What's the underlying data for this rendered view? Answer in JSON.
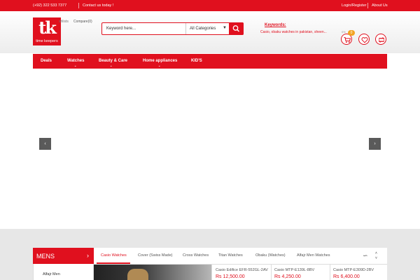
{
  "topbar": {
    "phone": "(+92) 322 533 7377",
    "contact": "Contact us today !",
    "login": "Login/Register",
    "about": "About Us"
  },
  "header": {
    "logo_mark": "tk",
    "logo_name": "time keepers",
    "wishlist_label": "shlists",
    "compare_label": "Compare(0)",
    "search_placeholder": "Keyword here...",
    "category_selected": "All Categories",
    "keywords_title": "Keywords:",
    "keywords_text": "Casio, obaku watches in pakistan, sheen...",
    "cart_count": "0",
    "cart_small_label": "0%"
  },
  "nav": {
    "items": [
      {
        "label": "Deals",
        "has_sub": false
      },
      {
        "label": "Watches",
        "has_sub": true
      },
      {
        "label": "Beauty & Care",
        "has_sub": true
      },
      {
        "label": "Home appliances",
        "has_sub": true
      },
      {
        "label": "KID'S",
        "has_sub": false
      }
    ]
  },
  "slider": {
    "prev_icon": "chevron-left-icon",
    "next_icon": "chevron-right-icon"
  },
  "section": {
    "category_title": "MENS",
    "category_items": [
      "Alfajr Men"
    ],
    "tabs": [
      {
        "label": "Casio Watches",
        "active": true
      },
      {
        "label": "Cover (Swiss Made)",
        "active": false
      },
      {
        "label": "Cross Watches",
        "active": false
      },
      {
        "label": "Titan Watches",
        "active": false
      },
      {
        "label": "Obaku (Watches)",
        "active": false
      },
      {
        "label": "Alfajr Men Watches",
        "active": false
      }
    ],
    "products": [
      {
        "name": "Casio Edifice EFR-552GL-2AV",
        "price": "Rs 12,500.00"
      },
      {
        "name": "Casio MTP-E139L-8BV",
        "price": "Rs 4,250.00"
      },
      {
        "name": "Casio MTP-E309D-2BV",
        "price": "Rs 6,400.00"
      }
    ]
  },
  "colors": {
    "brand_red": "#e0101e",
    "badge_orange": "#f2a422"
  }
}
